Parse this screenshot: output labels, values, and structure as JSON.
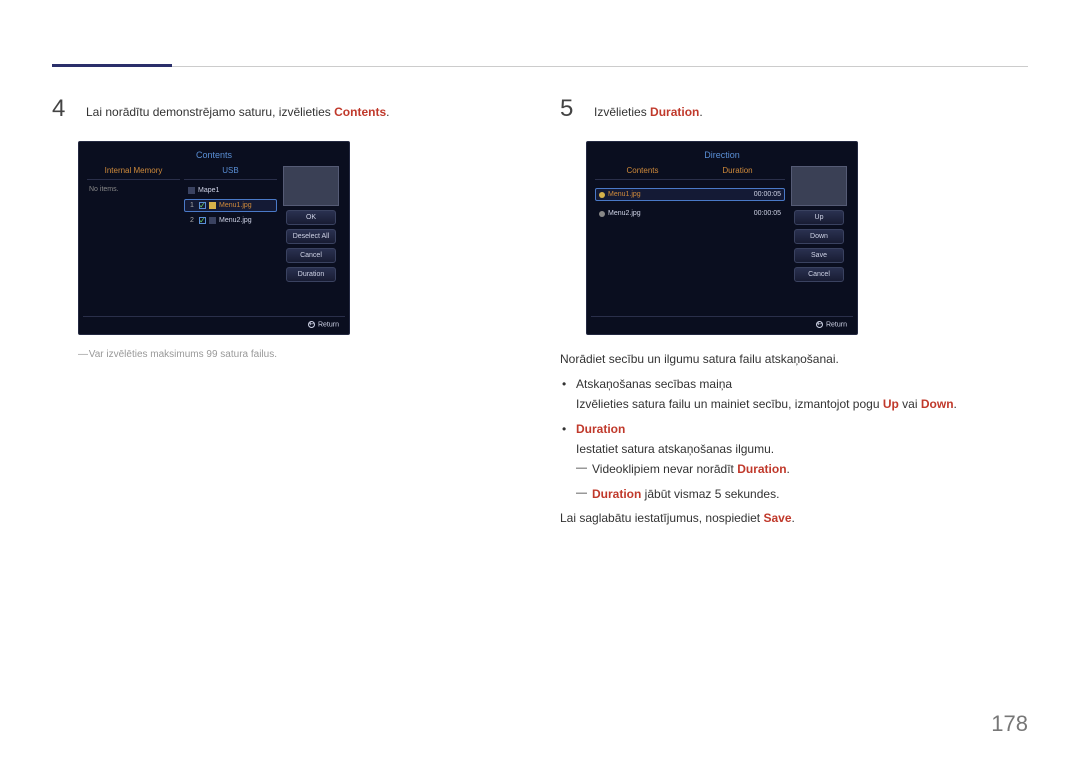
{
  "page_number": "178",
  "step4": {
    "num": "4",
    "text_a": "Lai norādītu demonstrējamo saturu, izvēlieties ",
    "kw": "Contents",
    "text_b": "."
  },
  "step5": {
    "num": "5",
    "text_a": "Izvēlieties ",
    "kw": "Duration",
    "text_b": "."
  },
  "tv_contents": {
    "title": "Contents",
    "col_internal": "Internal Memory",
    "col_usb": "USB",
    "no_items": "No items.",
    "folder": "Mape1",
    "row1_idx": "1",
    "row1_label": "Menu1.jpg",
    "row2_idx": "2",
    "row2_label": "Menu2.jpg",
    "btn_ok": "OK",
    "btn_deselect": "Deselect All",
    "btn_cancel": "Cancel",
    "btn_duration": "Duration",
    "return": "Return"
  },
  "tv_direction": {
    "title": "Direction",
    "col_contents": "Contents",
    "col_duration": "Duration",
    "row1_label": "Menu1.jpg",
    "row1_time": "00:00:05",
    "row2_label": "Menu2.jpg",
    "row2_time": "00:00:05",
    "btn_up": "Up",
    "btn_down": "Down",
    "btn_save": "Save",
    "btn_cancel": "Cancel",
    "return": "Return"
  },
  "footnote4": "Var izvēlēties maksimums 99 satura failus.",
  "body5": {
    "intro": "Norādiet secību un ilgumu satura failu atskaņošanai.",
    "b1_title": "Atskaņošanas secības maiņa",
    "b1_line_a": "Izvēlieties satura failu un mainiet secību, izmantojot pogu ",
    "b1_up": "Up",
    "b1_or": " vai ",
    "b1_down": "Down",
    "b1_line_b": ".",
    "b2_title": "Duration",
    "b2_line": "Iestatiet satura atskaņošanas ilgumu.",
    "d1_a": "Videoklipiem nevar norādīt ",
    "d1_kw": "Duration",
    "d1_b": ".",
    "d2_kw": "Duration",
    "d2_b": " jābūt vismaz 5 sekundes.",
    "save_a": "Lai saglabātu iestatījumus, nospiediet ",
    "save_kw": "Save",
    "save_b": "."
  }
}
